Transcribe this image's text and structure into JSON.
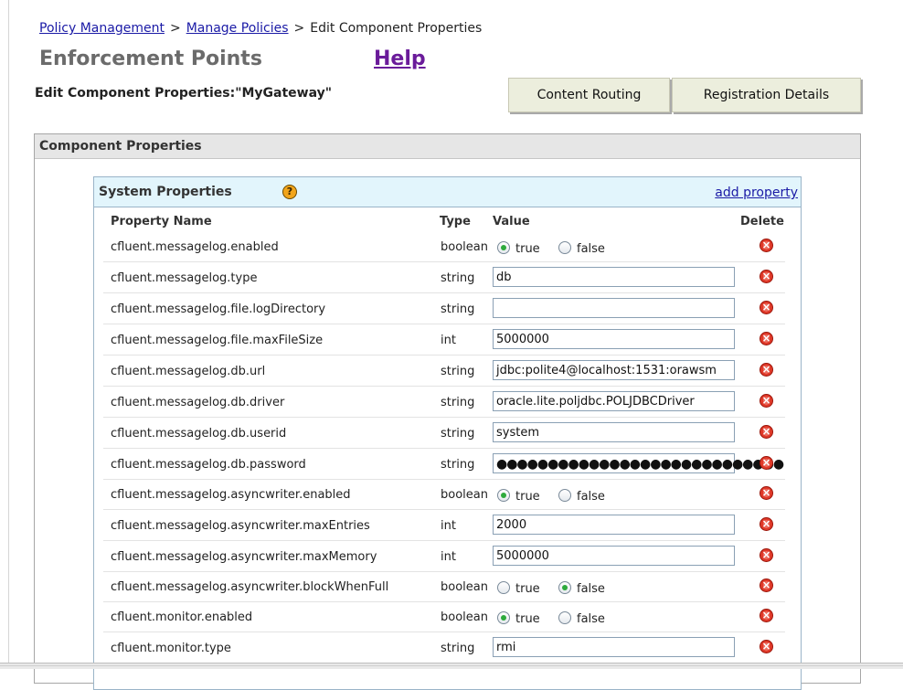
{
  "breadcrumb": {
    "item1": "Policy Management",
    "sep1": ">",
    "item2": "Manage Policies",
    "sep2": ">",
    "item3": "Edit Component Properties"
  },
  "header": {
    "title": "Enforcement Points",
    "help": "Help",
    "subtitle": "Edit Component Properties:\"MyGateway\""
  },
  "buttons": {
    "content_routing": "Content Routing",
    "registration_details": "Registration Details"
  },
  "component_panel": {
    "title": "Component Properties"
  },
  "system_panel": {
    "title": "System Properties",
    "help_glyph": "?",
    "add_link": "add property",
    "columns": {
      "name": "Property Name",
      "type": "Type",
      "value": "Value",
      "delete": "Delete"
    }
  },
  "radio_labels": {
    "true": "true",
    "false": "false"
  },
  "rows": [
    {
      "name": "cfluent.messagelog.enabled",
      "type": "boolean",
      "value": "true"
    },
    {
      "name": "cfluent.messagelog.type",
      "type": "string",
      "value": "db"
    },
    {
      "name": "cfluent.messagelog.file.logDirectory",
      "type": "string",
      "value": ""
    },
    {
      "name": "cfluent.messagelog.file.maxFileSize",
      "type": "int",
      "value": "5000000"
    },
    {
      "name": "cfluent.messagelog.db.url",
      "type": "string",
      "value": "jdbc:polite4@localhost:1531:orawsm"
    },
    {
      "name": "cfluent.messagelog.db.driver",
      "type": "string",
      "value": "oracle.lite.poljdbc.POLJDBCDriver"
    },
    {
      "name": "cfluent.messagelog.db.userid",
      "type": "string",
      "value": "system"
    },
    {
      "name": "cfluent.messagelog.db.password",
      "type": "string",
      "value": "●●●●●●●●●●●●●●●●●●●●●●●●●●●●"
    },
    {
      "name": "cfluent.messagelog.asyncwriter.enabled",
      "type": "boolean",
      "value": "true"
    },
    {
      "name": "cfluent.messagelog.asyncwriter.maxEntries",
      "type": "int",
      "value": "2000"
    },
    {
      "name": "cfluent.messagelog.asyncwriter.maxMemory",
      "type": "int",
      "value": "5000000"
    },
    {
      "name": "cfluent.messagelog.asyncwriter.blockWhenFull",
      "type": "boolean",
      "value": "false"
    },
    {
      "name": "cfluent.monitor.enabled",
      "type": "boolean",
      "value": "true"
    },
    {
      "name": "cfluent.monitor.type",
      "type": "string",
      "value": "rmi"
    }
  ],
  "icons": {
    "delete": "delete-icon",
    "help": "help-icon"
  },
  "colors": {
    "link": "#1a1aa6",
    "help": "#6a1b9a",
    "header_bg": "#e2f5fc",
    "radio_on": "#2eaa3c",
    "delete": "#e03a2a"
  }
}
